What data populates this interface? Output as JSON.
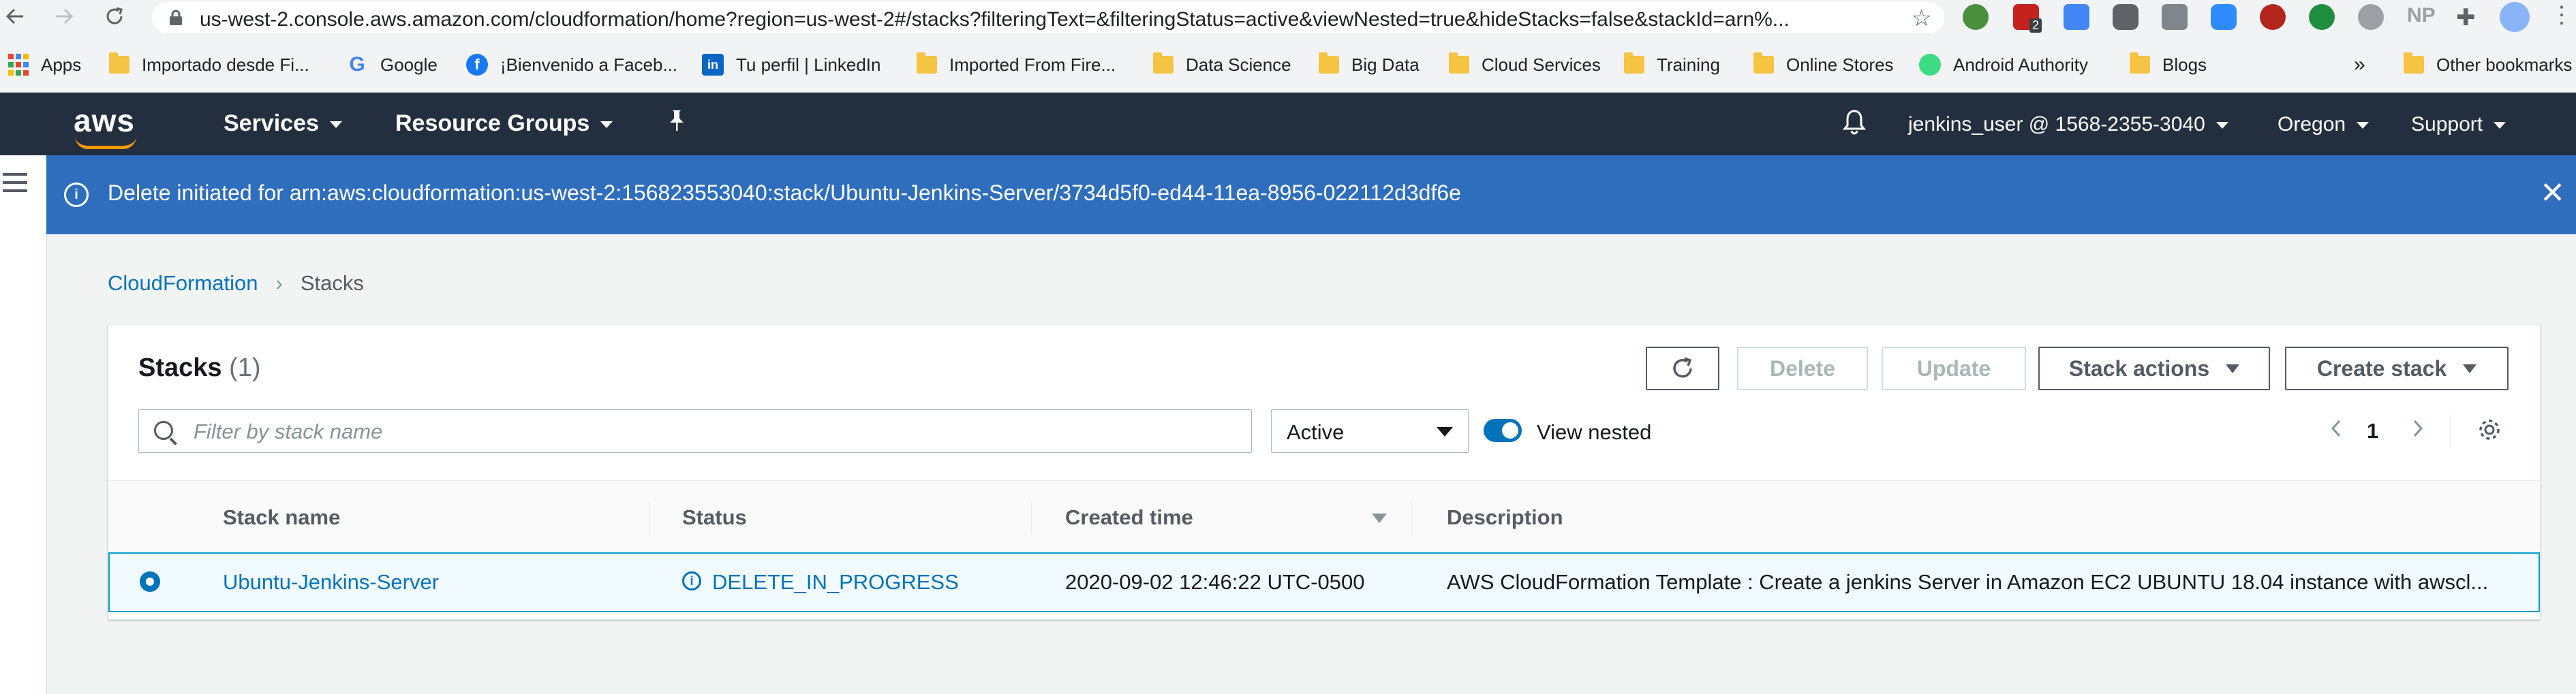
{
  "browser": {
    "url": "us-west-2.console.aws.amazon.com/cloudformation/home?region=us-west-2#/stacks?filteringText=&filteringStatus=active&viewNested=true&hideStacks=false&stackId=arn%...",
    "extension_badge": "2",
    "np_label": "NP",
    "bookmarks": [
      {
        "label": "Apps",
        "icon": "apps-grid-icon"
      },
      {
        "label": "Importado desde Fi...",
        "icon": "folder-icon"
      },
      {
        "label": "Google",
        "icon": "google-icon"
      },
      {
        "label": "¡Bienvenido a Faceb...",
        "icon": "facebook-icon"
      },
      {
        "label": "Tu perfil | LinkedIn",
        "icon": "linkedin-icon"
      },
      {
        "label": "Imported From Fire...",
        "icon": "folder-icon"
      },
      {
        "label": "Data Science",
        "icon": "folder-icon"
      },
      {
        "label": "Big Data",
        "icon": "folder-icon"
      },
      {
        "label": "Cloud Services",
        "icon": "folder-icon"
      },
      {
        "label": "Training",
        "icon": "folder-icon"
      },
      {
        "label": "Online Stores",
        "icon": "folder-icon"
      },
      {
        "label": "Android Authority",
        "icon": "android-icon"
      },
      {
        "label": "Blogs",
        "icon": "folder-icon"
      }
    ],
    "overflow": "»",
    "other_bookmarks": "Other bookmarks"
  },
  "aws_nav": {
    "logo": "aws",
    "services": "Services",
    "resource_groups": "Resource Groups",
    "account": "jenkins_user @ 1568-2355-3040",
    "region": "Oregon",
    "support": "Support"
  },
  "flash": {
    "message": "Delete initiated for arn:aws:cloudformation:us-west-2:156823553040:stack/Ubuntu-Jenkins-Server/3734d5f0-ed44-11ea-8956-022112d3df6e",
    "info_glyph": "i",
    "close_glyph": "✕"
  },
  "breadcrumb": {
    "root": "CloudFormation",
    "separator": "›",
    "current": "Stacks"
  },
  "stacks_panel": {
    "title": "Stacks",
    "count": "(1)",
    "buttons": {
      "delete": "Delete",
      "update": "Update",
      "stack_actions": "Stack actions",
      "create_stack": "Create stack"
    },
    "search_placeholder": "Filter by stack name",
    "status_filter": "Active",
    "view_nested_label": "View nested",
    "view_nested_on": true,
    "page": "1",
    "columns": [
      "Stack name",
      "Status",
      "Created time",
      "Description"
    ],
    "rows": [
      {
        "selected": true,
        "stack_name": "Ubuntu-Jenkins-Server",
        "status_icon": "i",
        "status": "DELETE_IN_PROGRESS",
        "created_time": "2020-09-02 12:46:22 UTC-0500",
        "description": "AWS CloudFormation Template : Create a jenkins Server in Amazon EC2 UBUNTU 18.04 instance with awscl..."
      }
    ]
  },
  "colors": {
    "aws_nav_bg": "#232f3e",
    "flash_bg": "#2f6ebd",
    "link": "#0073bb",
    "selected_row_border": "#00a1c9"
  }
}
